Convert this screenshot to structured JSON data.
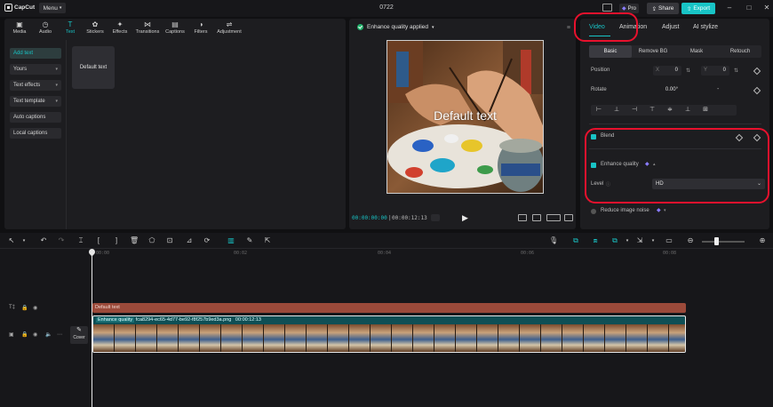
{
  "titlebar": {
    "app_name": "CapCut",
    "menu_label": "Menu",
    "project_title": "0722",
    "pro_label": "Pro",
    "share_label": "Share",
    "export_label": "Export"
  },
  "tool_tabs": [
    {
      "label": "Media",
      "icon": "media-icon"
    },
    {
      "label": "Audio",
      "icon": "audio-icon"
    },
    {
      "label": "Text",
      "icon": "text-icon",
      "active": true
    },
    {
      "label": "Stickers",
      "icon": "stickers-icon"
    },
    {
      "label": "Effects",
      "icon": "effects-icon"
    },
    {
      "label": "Transitions",
      "icon": "transitions-icon"
    },
    {
      "label": "Captions",
      "icon": "captions-icon"
    },
    {
      "label": "Filters",
      "icon": "filters-icon"
    },
    {
      "label": "Adjustment",
      "icon": "adjustment-icon"
    }
  ],
  "left_sidebar": {
    "items": [
      {
        "label": "Add text",
        "active": true
      },
      {
        "label": "Yours",
        "dropdown": true
      },
      {
        "label": "Text effects",
        "dropdown": true
      },
      {
        "label": "Text template",
        "dropdown": true
      },
      {
        "label": "Auto captions"
      },
      {
        "label": "Local captions"
      }
    ],
    "default_card_label": "Default text"
  },
  "player": {
    "header_label": "Enhance quality applied",
    "canvas_text": "Default text",
    "current_time": "00:00:00:00",
    "total_time": "00:00:12:13"
  },
  "right_panel": {
    "tabs": [
      "Video",
      "Animation",
      "Adjust",
      "AI stylize"
    ],
    "active_tab": "Video",
    "subtabs": [
      "Basic",
      "Remove BG",
      "Mask",
      "Retouch"
    ],
    "active_subtab": "Basic",
    "position_label": "Position",
    "position_x_axis": "X",
    "position_x": "0",
    "position_y_axis": "Y",
    "position_y": "0",
    "rotate_label": "Rotate",
    "rotate_value": "0.00°",
    "rotate_dash": "-",
    "blend_label": "Blend",
    "enhance_label": "Enhance quality",
    "level_label": "Level",
    "level_value": "HD",
    "reduce_noise_label": "Reduce image noise"
  },
  "timeline": {
    "ruler_labels": [
      "00:00",
      "00:02",
      "00:04",
      "00:06",
      "00:08"
    ],
    "text_clip_label": "Default text",
    "video_clip_tag": "Enhance quality",
    "video_clip_name": "fca8294-ec65-4d77-be92-f8f257b9ed3a.png",
    "video_clip_duration": "00:00:12:13",
    "cover_label": "Cover"
  },
  "colors": {
    "accent": "#18c4c6",
    "annotation": "#e8112d",
    "text_clip": "#9b4a3a",
    "video_clip": "#0f4f55"
  }
}
